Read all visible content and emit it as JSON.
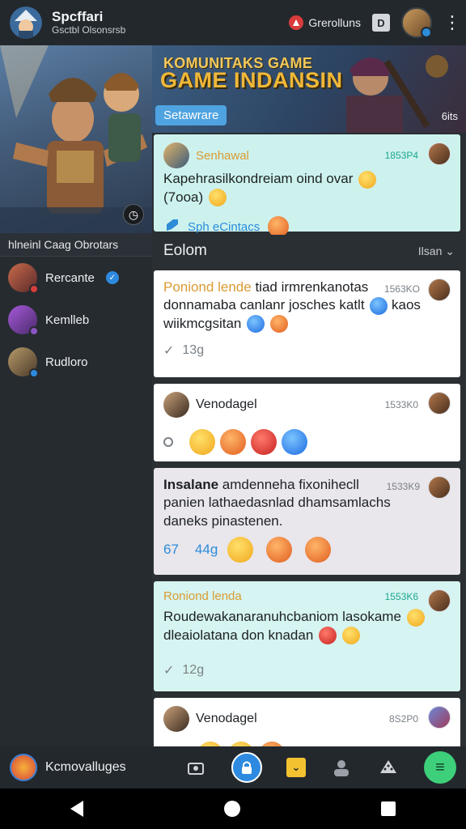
{
  "topbar": {
    "app_name": "Spcffari",
    "app_subtitle": "Gsctbl Olsonsrsb",
    "status_label": "Grerolluns",
    "square_label": "D"
  },
  "left": {
    "section_label": "hlneinl Caag Obrotars",
    "friends": [
      {
        "name": "Rercante",
        "verified": true,
        "badge_color": "#d93c3c"
      },
      {
        "name": "Kemlleb",
        "verified": false,
        "badge_color": "#8a55c2"
      },
      {
        "name": "Rudloro",
        "verified": false,
        "badge_color": "#2d8ae0"
      }
    ]
  },
  "banner": {
    "title_line1": "KOMUNITAKS GAME",
    "title_line2": "GAME INDANSIN",
    "cta": "Setawrare",
    "corner": "6its"
  },
  "feed": {
    "sort_title": "Eolom",
    "sort_right": "Ilsan",
    "posts": [
      {
        "user": "Senhawal",
        "time": "1853P4",
        "body": "Kapehrasilkondreiam oind ovar",
        "body2": "(7ooa)",
        "footer": "Sph eCintacs"
      },
      {
        "user": "Poniond lende",
        "user_suffix": "tiad irmrenkanotas",
        "time": "1563KO",
        "body": "donnamaba canlanr josches katlt",
        "body_end": "kaos",
        "body2": "wiikmcgsitan",
        "count": "13g"
      },
      {
        "user": "Venodagel",
        "time": "1533K0"
      },
      {
        "user": "Insalane",
        "user_suffix": "amdenneha fixonihecll",
        "time": "1533K9",
        "body": "panien lathaedasnlad dhamsamlachs",
        "body2": "daneks pinastenen.",
        "count_a": "67",
        "count_b": "44g"
      },
      {
        "user": "Roniond lenda",
        "time": "1553K6",
        "body": "Roudewakanaranuhcbaniom lasokame",
        "body2": "dleaiolatana don knadan",
        "count": "12g"
      },
      {
        "user": "Venodagel",
        "time": "8S2P0"
      }
    ]
  },
  "bottom": {
    "app_name": "Kcmovalluges"
  }
}
